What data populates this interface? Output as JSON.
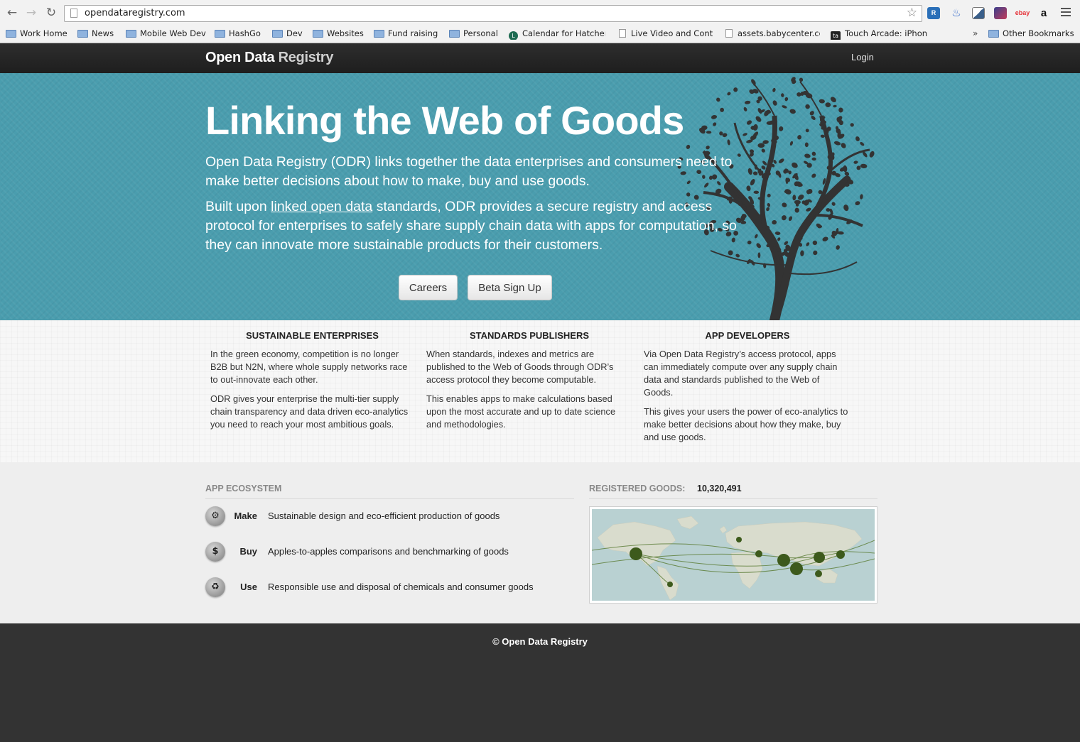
{
  "browser": {
    "url": "opendataregistry.com",
    "bookmarks": [
      {
        "label": "Work Home",
        "icon": "folder"
      },
      {
        "label": "News",
        "icon": "folder"
      },
      {
        "label": "Mobile Web Dev",
        "icon": "folder"
      },
      {
        "label": "HashGo",
        "icon": "folder"
      },
      {
        "label": "Dev",
        "icon": "folder"
      },
      {
        "label": "Websites",
        "icon": "folder"
      },
      {
        "label": "Fund raising",
        "icon": "folder"
      },
      {
        "label": "Personal",
        "icon": "folder"
      },
      {
        "label": "Calendar for Hatcher",
        "icon": "calendar"
      },
      {
        "label": "Live Video and Conti",
        "icon": "page"
      },
      {
        "label": "assets.babycenter.co",
        "icon": "page"
      },
      {
        "label": "Touch Arcade: iPhon",
        "icon": "touch-arcade"
      }
    ],
    "overflow": "»",
    "other_bookmarks": "Other Bookmarks",
    "extensions": [
      {
        "name": "readability-icon",
        "color": "#2a6fb8",
        "glyph": "R"
      },
      {
        "name": "flame-icon",
        "color": "#3a6fd0",
        "glyph": "🔥"
      },
      {
        "name": "screenshot-icon",
        "color": "#6a7a8a",
        "glyph": ""
      },
      {
        "name": "feedly-icon",
        "color": "#3a3f8c",
        "glyph": ""
      },
      {
        "name": "ebay-icon",
        "color": "#ffffff",
        "glyph": "ebay"
      },
      {
        "name": "amazon-icon",
        "color": "#ffffff",
        "glyph": "a"
      }
    ]
  },
  "site": {
    "brand_open": "Open Data",
    "brand_registry": "Registry",
    "login": "Login"
  },
  "hero": {
    "title": "Linking the Web of Goods",
    "p1": "Open Data Registry (ODR) links together the data enterprises and consumers need to make better decisions about how to make, buy and use goods.",
    "p2_before": "Built upon ",
    "p2_link": "linked open data",
    "p2_after": " standards, ODR provides a secure registry and access protocol for enterprises to safely share supply chain data with apps for computation, so they can innovate more sustainable products for their customers.",
    "careers": "Careers",
    "beta": "Beta Sign Up"
  },
  "features": [
    {
      "title": "SUSTAINABLE ENTERPRISES",
      "paras": [
        "In the green economy, competition is no longer B2B but N2N, where whole supply networks race to out-innovate each other.",
        "ODR gives your enterprise the multi-tier supply chain transparency and data driven eco-analytics you need to reach your most ambitious goals."
      ]
    },
    {
      "title": "STANDARDS PUBLISHERS",
      "paras": [
        "When standards, indexes and metrics are published to the Web of Goods through ODR’s access protocol they become computable.",
        "This enables apps to make calculations based upon the most accurate and up to date science and methodologies."
      ]
    },
    {
      "title": "APP DEVELOPERS",
      "paras": [
        "Via Open Data Registry’s access protocol, apps can immediately compute over any supply chain data and standards published to the Web of Goods.",
        "This gives your users the power of eco-analytics to make better decisions about how they make, buy and use goods."
      ]
    }
  ],
  "ecosystem": {
    "heading": "APP ECOSYSTEM",
    "items": [
      {
        "label": "Make",
        "desc": "Sustainable design and eco-efficient production of goods",
        "icon": "gear-icon"
      },
      {
        "label": "Buy",
        "desc": "Apples-to-apples comparisons and benchmarking of goods",
        "icon": "dollar-icon"
      },
      {
        "label": "Use",
        "desc": "Responsible use and disposal of chemicals and consumer goods",
        "icon": "recycle-icon"
      }
    ]
  },
  "registered": {
    "label": "REGISTERED GOODS:",
    "count": "10,320,491"
  },
  "footer": {
    "copyright": "© Open Data Registry"
  },
  "colors": {
    "hero_bg": "#4a9dae",
    "navbar_bg": "#222222",
    "footer_bg": "#333333",
    "map_marker": "#3d5a1c"
  }
}
